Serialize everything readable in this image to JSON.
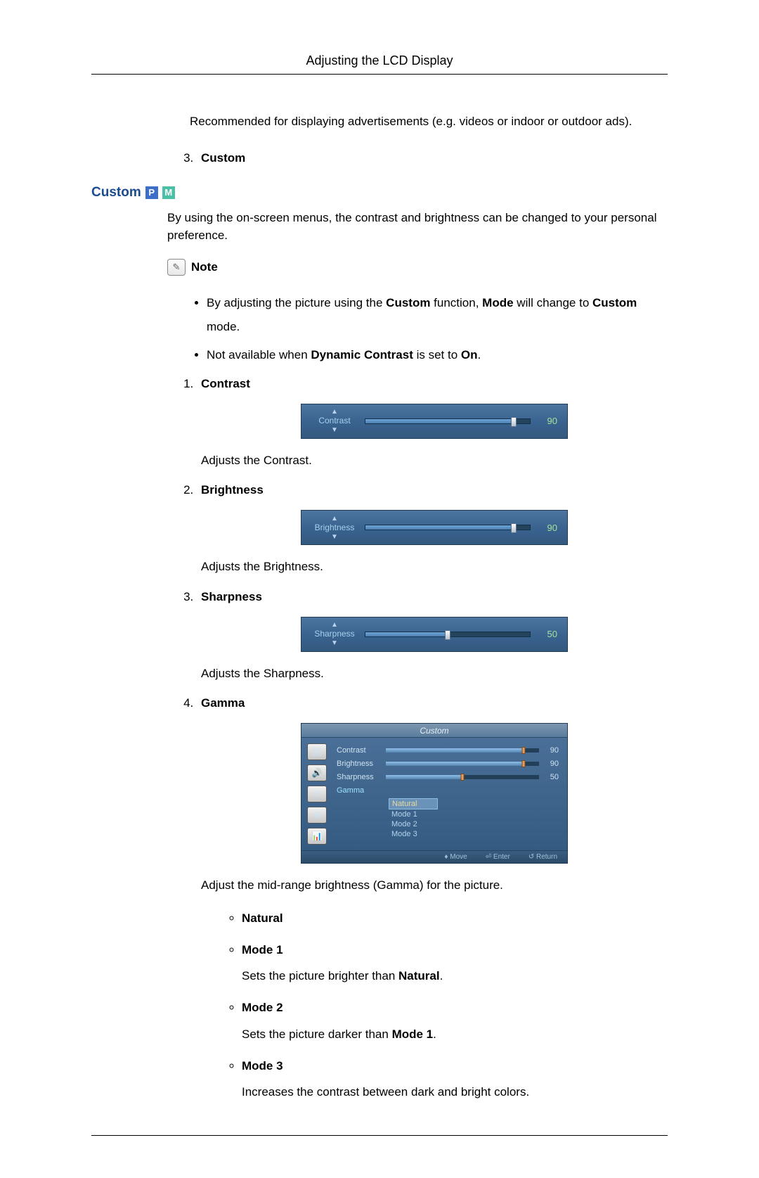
{
  "header": {
    "title": "Adjusting the LCD Display"
  },
  "intro_line": "Recommended for displaying advertisements (e.g. videos or indoor or outdoor ads).",
  "pre_list": {
    "start": 3,
    "item_label": "Custom"
  },
  "section": {
    "title": "Custom",
    "badge_p": "P",
    "badge_m": "M"
  },
  "section_intro": "By using the on-screen menus, the contrast and brightness can be changed to your personal preference.",
  "note": {
    "label": "Note",
    "icon_glyph": "✎"
  },
  "note_items": [
    {
      "pre": "By adjusting the picture using the ",
      "b1": "Custom",
      "mid": " function, ",
      "b2": "Mode",
      "mid2": " will change to ",
      "b3": "Custom",
      "post": " mode."
    },
    {
      "pre": "Not available when ",
      "b1": "Dynamic Contrast",
      "mid": " is set to ",
      "b2": "On",
      "post": ".",
      "b3": "",
      "mid2": ""
    }
  ],
  "items": [
    {
      "label": "Contrast",
      "slider": {
        "name": "Contrast",
        "value": 90,
        "pct": 90
      },
      "desc": "Adjusts the Contrast."
    },
    {
      "label": "Brightness",
      "slider": {
        "name": "Brightness",
        "value": 90,
        "pct": 90
      },
      "desc": "Adjusts the Brightness."
    },
    {
      "label": "Sharpness",
      "slider": {
        "name": "Sharpness",
        "value": 50,
        "pct": 50
      },
      "desc": "Adjusts the Sharpness."
    },
    {
      "label": "Gamma",
      "osd": {
        "title": "Custom",
        "rows": [
          {
            "label": "Contrast",
            "value": 90,
            "pct": 90
          },
          {
            "label": "Brightness",
            "value": 90,
            "pct": 90
          },
          {
            "label": "Sharpness",
            "value": 50,
            "pct": 50
          }
        ],
        "gamma_label": "Gamma",
        "options": [
          "Natural",
          "Mode 1",
          "Mode 2",
          "Mode 3"
        ],
        "selected": 0,
        "footer": {
          "move": "Move",
          "enter": "Enter",
          "return": "Return"
        }
      },
      "desc": "Adjust the mid-range brightness (Gamma) for the picture.",
      "gamma_opts": [
        {
          "title": "Natural",
          "desc": ""
        },
        {
          "title": "Mode 1",
          "desc_pre": "Sets the picture brighter than ",
          "desc_b": "Natural",
          "desc_post": "."
        },
        {
          "title": "Mode 2",
          "desc_pre": "Sets the picture darker than ",
          "desc_b": "Mode 1",
          "desc_post": "."
        },
        {
          "title": "Mode 3",
          "desc_pre": "Increases the contrast between dark and bright colors.",
          "desc_b": "",
          "desc_post": ""
        }
      ]
    }
  ]
}
